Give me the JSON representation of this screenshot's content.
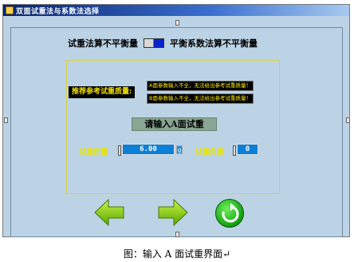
{
  "window": {
    "title": "双面试重法与系数法选择"
  },
  "toggle_row": {
    "left_label": "试重法算不平衡量",
    "right_label": "平衡系数法算不平衡量"
  },
  "reference": {
    "label": "推荐参考试重质量:",
    "messages": [
      "A面参数输入不全，无法给出参考试重质量！",
      "B面参数输入不全，无法给出参考试重质量！"
    ]
  },
  "prompt": "请输入A面试重",
  "fields": {
    "mass_label": "试重质量",
    "mass_value": "6.00",
    "mass_unit": "g",
    "angle_label": "试重角度",
    "angle_value": "0"
  },
  "buttons": {
    "back": "back-arrow-icon",
    "forward": "forward-arrow-icon",
    "refresh": "refresh-icon"
  },
  "caption": "图：输入 A 面试重界面↵",
  "colors": {
    "window_bg": "#bcd3e6",
    "label_yellow": "#e9e400",
    "field_blue": "#0c7fd7",
    "toggle_on": "#0a23c8",
    "arrow_green": "#8fd400"
  }
}
